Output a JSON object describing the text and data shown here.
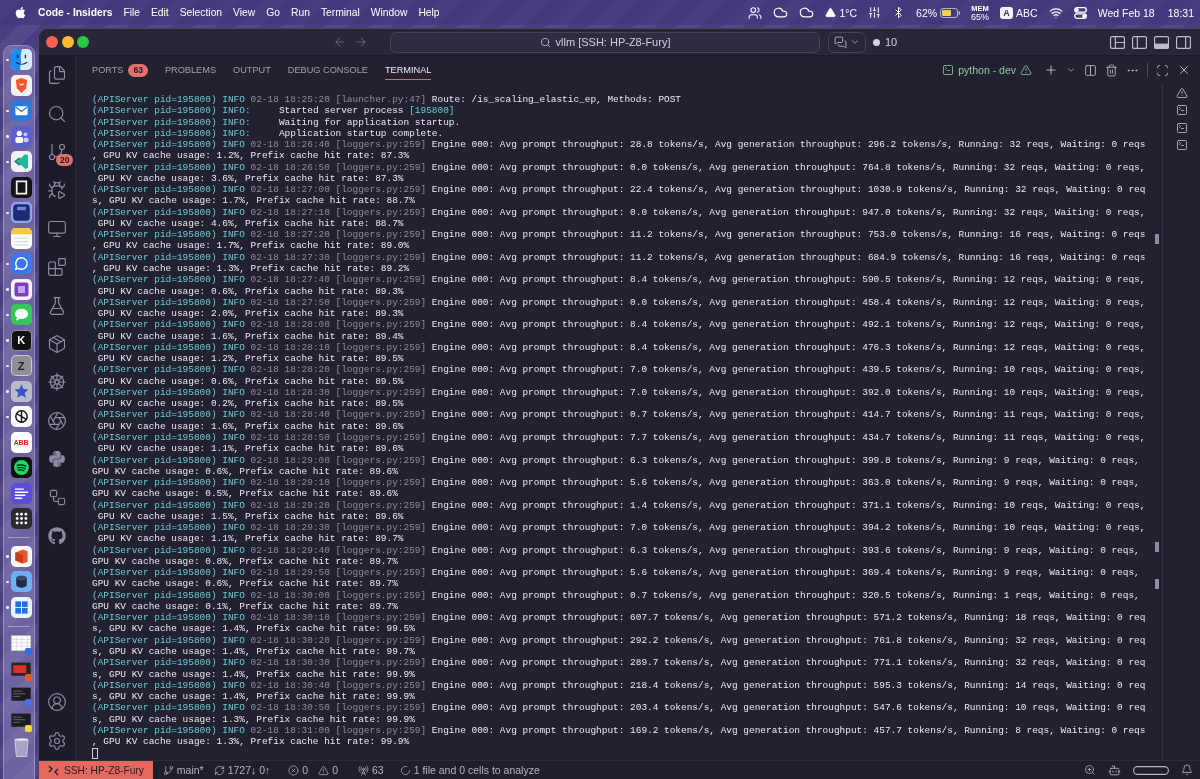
{
  "menu_bar": {
    "app": "Code - Insiders",
    "menus": [
      "File",
      "Edit",
      "Selection",
      "View",
      "Go",
      "Run",
      "Terminal",
      "Window",
      "Help"
    ],
    "weather": "1°C",
    "battery": "62%",
    "memory_label": "MEM",
    "memory": "65%",
    "input_badge": "A",
    "input": "ABC",
    "date": "Wed Feb 18",
    "time": "18:31"
  },
  "dock": {
    "groups": [
      {
        "items": [
          {
            "kind": "finder",
            "running": true
          },
          {
            "kind": "browser",
            "running": false
          },
          {
            "kind": "mail",
            "running": true
          },
          {
            "kind": "team",
            "running": true
          },
          {
            "kind": "editor",
            "running": true
          },
          {
            "kind": "frame",
            "running": false
          },
          {
            "kind": "navy",
            "running": true
          },
          {
            "kind": "notes",
            "running": false
          },
          {
            "kind": "bubble",
            "running": true
          },
          {
            "kind": "notebook",
            "running": true
          },
          {
            "kind": "messages",
            "running": true
          },
          {
            "kind": "darkletter",
            "label": "K",
            "running": true
          },
          {
            "kind": "grayletter",
            "label": "Z",
            "running": true
          },
          {
            "kind": "star",
            "running": true
          },
          {
            "kind": "knot",
            "running": true
          },
          {
            "kind": "lightletter",
            "label": "ABB",
            "running": false
          },
          {
            "kind": "music",
            "running": false
          },
          {
            "kind": "lines",
            "running": false
          },
          {
            "kind": "launcher",
            "running": false
          }
        ]
      },
      {
        "items": [
          {
            "kind": "office",
            "running": true
          },
          {
            "kind": "cylinder",
            "running": true
          },
          {
            "kind": "windows",
            "running": true
          }
        ]
      },
      {
        "items": [
          {
            "kind": "sheet",
            "running": false
          },
          {
            "kind": "redwindow",
            "running": false
          },
          {
            "kind": "darkwindow",
            "running": false
          },
          {
            "kind": "notewindow",
            "running": false
          },
          {
            "kind": "trash",
            "running": false
          }
        ]
      }
    ]
  },
  "window": {
    "title": "vllm [SSH: HP-Z8-Fury]",
    "sessions": "10",
    "layout_toggles": [
      {
        "kind": "sidebar",
        "on": false
      },
      {
        "kind": "panel",
        "on": true
      },
      {
        "kind": "auxiliary",
        "on": false
      }
    ]
  },
  "activity_bar": {
    "items": [
      {
        "kind": "explorer"
      },
      {
        "kind": "search"
      },
      {
        "kind": "scm",
        "badge": "20"
      },
      {
        "kind": "debug"
      },
      {
        "kind": "remote"
      },
      {
        "kind": "extensions"
      },
      {
        "kind": "testing"
      },
      {
        "kind": "containers"
      },
      {
        "kind": "kubernetes"
      },
      {
        "kind": "knot"
      },
      {
        "kind": "python"
      },
      {
        "kind": "diagram"
      },
      {
        "kind": "github"
      }
    ],
    "bottom": [
      {
        "kind": "account"
      },
      {
        "kind": "settings"
      }
    ]
  },
  "panel": {
    "tabs": [
      {
        "label": "PORTS",
        "badge": "63",
        "selected": false
      },
      {
        "label": "PROBLEMS",
        "selected": false
      },
      {
        "label": "OUTPUT",
        "selected": false
      },
      {
        "label": "DEBUG CONSOLE",
        "selected": false
      },
      {
        "label": "TERMINAL",
        "selected": true
      }
    ],
    "terminal_name": "python - dev"
  },
  "terminal": {
    "lines": [
      {
        "kind": "logger",
        "source": "(APIServer pid=195800)",
        "tag": "INFO",
        "stamp": "02-18 18:25:20 [launcher.py:47]",
        "message": "Route: /is_scaling_elastic_ep, Methods: POST"
      },
      {
        "kind": "uvicorn",
        "source": "(APIServer pid=195800)",
        "tag": "INFO:",
        "message": "Started server process",
        "detail": "[195800]"
      },
      {
        "kind": "uvicorn",
        "source": "(APIServer pid=195800)",
        "tag": "INFO:",
        "message": "Waiting for application startup."
      },
      {
        "kind": "uvicorn",
        "source": "(APIServer pid=195800)",
        "tag": "INFO:",
        "message": "Application startup complete."
      },
      {
        "kind": "logger",
        "source": "(APIServer pid=195800)",
        "tag": "INFO",
        "stamp": "02-18 18:26:40 [loggers.py:259]",
        "message": "Engine 000: Avg prompt throughput: 28.8 tokens/s, Avg generation throughput: 296.2 tokens/s, Running: 32 reqs, Waiting: 0 reqs",
        "wrap": ", GPU KV cache usage: 1.2%, Prefix cache hit rate: 87.3%"
      },
      {
        "kind": "logger",
        "source": "(APIServer pid=195800)",
        "tag": "INFO",
        "stamp": "02-18 18:26:50 [loggers.py:259]",
        "message": "Engine 000: Avg prompt throughput: 0.0 tokens/s, Avg generation throughput: 764.8 tokens/s, Running: 32 reqs, Waiting: 0 reqs,",
        "wrap": " GPU KV cache usage: 3.6%, Prefix cache hit rate: 87.3%"
      },
      {
        "kind": "logger",
        "source": "(APIServer pid=195800)",
        "tag": "INFO",
        "stamp": "02-18 18:27:00 [loggers.py:259]",
        "message": "Engine 000: Avg prompt throughput: 22.4 tokens/s, Avg generation throughput: 1030.9 tokens/s, Running: 32 reqs, Waiting: 0 req",
        "wrap": "s, GPU KV cache usage: 1.7%, Prefix cache hit rate: 88.7%"
      },
      {
        "kind": "logger",
        "source": "(APIServer pid=195800)",
        "tag": "INFO",
        "stamp": "02-18 18:27:10 [loggers.py:259]",
        "message": "Engine 000: Avg prompt throughput: 0.0 tokens/s, Avg generation throughput: 947.0 tokens/s, Running: 32 reqs, Waiting: 0 reqs,",
        "wrap": " GPU KV cache usage: 4.6%, Prefix cache hit rate: 88.7%"
      },
      {
        "kind": "logger",
        "source": "(APIServer pid=195800)",
        "tag": "INFO",
        "stamp": "02-18 18:27:20 [loggers.py:259]",
        "message": "Engine 000: Avg prompt throughput: 11.2 tokens/s, Avg generation throughput: 753.0 tokens/s, Running: 16 reqs, Waiting: 0 reqs",
        "wrap": ", GPU KV cache usage: 1.7%, Prefix cache hit rate: 89.0%"
      },
      {
        "kind": "logger",
        "source": "(APIServer pid=195800)",
        "tag": "INFO",
        "stamp": "02-18 18:27:30 [loggers.py:259]",
        "message": "Engine 000: Avg prompt throughput: 11.2 tokens/s, Avg generation throughput: 684.9 tokens/s, Running: 16 reqs, Waiting: 0 reqs",
        "wrap": ", GPU KV cache usage: 1.3%, Prefix cache hit rate: 89.2%"
      },
      {
        "kind": "logger",
        "source": "(APIServer pid=195800)",
        "tag": "INFO",
        "stamp": "02-18 18:27:40 [loggers.py:259]",
        "message": "Engine 000: Avg prompt throughput: 8.4 tokens/s, Avg generation throughput: 590.5 tokens/s, Running: 12 reqs, Waiting: 0 reqs,",
        "wrap": " GPU KV cache usage: 0.6%, Prefix cache hit rate: 89.3%"
      },
      {
        "kind": "logger",
        "source": "(APIServer pid=195800)",
        "tag": "INFO",
        "stamp": "02-18 18:27:50 [loggers.py:259]",
        "message": "Engine 000: Avg prompt throughput: 0.0 tokens/s, Avg generation throughput: 458.4 tokens/s, Running: 12 reqs, Waiting: 0 reqs,",
        "wrap": " GPU KV cache usage: 2.0%, Prefix cache hit rate: 89.3%"
      },
      {
        "kind": "logger",
        "source": "(APIServer pid=195800)",
        "tag": "INFO",
        "stamp": "02-18 18:28:00 [loggers.py:259]",
        "message": "Engine 000: Avg prompt throughput: 8.4 tokens/s, Avg generation throughput: 492.1 tokens/s, Running: 12 reqs, Waiting: 0 reqs,",
        "wrap": " GPU KV cache usage: 1.6%, Prefix cache hit rate: 89.4%"
      },
      {
        "kind": "logger",
        "source": "(APIServer pid=195800)",
        "tag": "INFO",
        "stamp": "02-18 18:28:10 [loggers.py:259]",
        "message": "Engine 000: Avg prompt throughput: 8.4 tokens/s, Avg generation throughput: 476.3 tokens/s, Running: 12 reqs, Waiting: 0 reqs,",
        "wrap": " GPU KV cache usage: 1.2%, Prefix cache hit rate: 89.5%"
      },
      {
        "kind": "logger",
        "source": "(APIServer pid=195800)",
        "tag": "INFO",
        "stamp": "02-18 18:28:20 [loggers.py:259]",
        "message": "Engine 000: Avg prompt throughput: 7.0 tokens/s, Avg generation throughput: 439.5 tokens/s, Running: 10 reqs, Waiting: 0 reqs,",
        "wrap": " GPU KV cache usage: 0.6%, Prefix cache hit rate: 89.5%"
      },
      {
        "kind": "logger",
        "source": "(APIServer pid=195800)",
        "tag": "INFO",
        "stamp": "02-18 18:28:30 [loggers.py:259]",
        "message": "Engine 000: Avg prompt throughput: 7.0 tokens/s, Avg generation throughput: 392.0 tokens/s, Running: 10 reqs, Waiting: 0 reqs,",
        "wrap": " GPU KV cache usage: 0.2%, Prefix cache hit rate: 89.5%"
      },
      {
        "kind": "logger",
        "source": "(APIServer pid=195800)",
        "tag": "INFO",
        "stamp": "02-18 18:28:40 [loggers.py:259]",
        "message": "Engine 000: Avg prompt throughput: 0.7 tokens/s, Avg generation throughput: 414.7 tokens/s, Running: 11 reqs, Waiting: 0 reqs,",
        "wrap": " GPU KV cache usage: 1.6%, Prefix cache hit rate: 89.6%"
      },
      {
        "kind": "logger",
        "source": "(APIServer pid=195800)",
        "tag": "INFO",
        "stamp": "02-18 18:28:50 [loggers.py:259]",
        "message": "Engine 000: Avg prompt throughput: 7.7 tokens/s, Avg generation throughput: 434.7 tokens/s, Running: 11 reqs, Waiting: 0 reqs,",
        "wrap": " GPU KV cache usage: 1.1%, Prefix cache hit rate: 89.6%"
      },
      {
        "kind": "logger",
        "source": "(APIServer pid=195800)",
        "tag": "INFO",
        "stamp": "02-18 18:29:00 [loggers.py:259]",
        "message": "Engine 000: Avg prompt throughput: 6.3 tokens/s, Avg generation throughput: 399.8 tokens/s, Running: 9 reqs, Waiting: 0 reqs,",
        "wrap": "GPU KV cache usage: 0.6%, Prefix cache hit rate: 89.6%"
      },
      {
        "kind": "logger",
        "source": "(APIServer pid=195800)",
        "tag": "INFO",
        "stamp": "02-18 18:29:10 [loggers.py:259]",
        "message": "Engine 000: Avg prompt throughput: 5.6 tokens/s, Avg generation throughput: 363.0 tokens/s, Running: 9 reqs, Waiting: 0 reqs,",
        "wrap": "GPU KV cache usage: 0.5%, Prefix cache hit rate: 89.6%"
      },
      {
        "kind": "logger",
        "source": "(APIServer pid=195800)",
        "tag": "INFO",
        "stamp": "02-18 18:29:20 [loggers.py:259]",
        "message": "Engine 000: Avg prompt throughput: 1.4 tokens/s, Avg generation throughput: 371.1 tokens/s, Running: 10 reqs, Waiting: 0 reqs,",
        "wrap": " GPU KV cache usage: 1.5%, Prefix cache hit rate: 89.6%"
      },
      {
        "kind": "logger",
        "source": "(APIServer pid=195800)",
        "tag": "INFO",
        "stamp": "02-18 18:29:30 [loggers.py:259]",
        "message": "Engine 000: Avg prompt throughput: 7.0 tokens/s, Avg generation throughput: 394.2 tokens/s, Running: 10 reqs, Waiting: 0 reqs,",
        "wrap": " GPU KV cache usage: 1.1%, Prefix cache hit rate: 89.7%"
      },
      {
        "kind": "logger",
        "source": "(APIServer pid=195800)",
        "tag": "INFO",
        "stamp": "02-18 18:29:40 [loggers.py:259]",
        "message": "Engine 000: Avg prompt throughput: 6.3 tokens/s, Avg generation throughput: 393.6 tokens/s, Running: 9 reqs, Waiting: 0 reqs,",
        "wrap": "GPU KV cache usage: 0.8%, Prefix cache hit rate: 89.7%"
      },
      {
        "kind": "logger",
        "source": "(APIServer pid=195800)",
        "tag": "INFO",
        "stamp": "02-18 18:29:50 [loggers.py:259]",
        "message": "Engine 000: Avg prompt throughput: 5.6 tokens/s, Avg generation throughput: 369.4 tokens/s, Running: 9 reqs, Waiting: 0 reqs,",
        "wrap": "GPU KV cache usage: 0.6%, Prefix cache hit rate: 89.7%"
      },
      {
        "kind": "logger",
        "source": "(APIServer pid=195800)",
        "tag": "INFO",
        "stamp": "02-18 18:30:00 [loggers.py:259]",
        "message": "Engine 000: Avg prompt throughput: 0.7 tokens/s, Avg generation throughput: 320.5 tokens/s, Running: 1 reqs, Waiting: 0 reqs,",
        "wrap": "GPU KV cache usage: 0.1%, Prefix cache hit rate: 89.7%"
      },
      {
        "kind": "logger",
        "source": "(APIServer pid=195800)",
        "tag": "INFO",
        "stamp": "02-18 18:30:10 [loggers.py:259]",
        "message": "Engine 000: Avg prompt throughput: 607.7 tokens/s, Avg generation throughput: 571.2 tokens/s, Running: 18 reqs, Waiting: 0 req",
        "wrap": "s, GPU KV cache usage: 1.4%, Prefix cache hit rate: 99.5%"
      },
      {
        "kind": "logger",
        "source": "(APIServer pid=195800)",
        "tag": "INFO",
        "stamp": "02-18 18:30:20 [loggers.py:259]",
        "message": "Engine 000: Avg prompt throughput: 292.2 tokens/s, Avg generation throughput: 761.8 tokens/s, Running: 32 reqs, Waiting: 0 req",
        "wrap": "s, GPU KV cache usage: 1.4%, Prefix cache hit rate: 99.7%"
      },
      {
        "kind": "logger",
        "source": "(APIServer pid=195800)",
        "tag": "INFO",
        "stamp": "02-18 18:30:30 [loggers.py:259]",
        "message": "Engine 000: Avg prompt throughput: 289.7 tokens/s, Avg generation throughput: 771.1 tokens/s, Running: 32 reqs, Waiting: 0 req",
        "wrap": "s, GPU KV cache usage: 1.4%, Prefix cache hit rate: 99.9%"
      },
      {
        "kind": "logger",
        "source": "(APIServer pid=195800)",
        "tag": "INFO",
        "stamp": "02-18 18:30:40 [loggers.py:259]",
        "message": "Engine 000: Avg prompt throughput: 218.4 tokens/s, Avg generation throughput: 595.3 tokens/s, Running: 14 reqs, Waiting: 0 req",
        "wrap": "s, GPU KV cache usage: 1.4%, Prefix cache hit rate: 99.9%"
      },
      {
        "kind": "logger",
        "source": "(APIServer pid=195800)",
        "tag": "INFO",
        "stamp": "02-18 18:30:50 [loggers.py:259]",
        "message": "Engine 000: Avg prompt throughput: 203.4 tokens/s, Avg generation throughput: 547.6 tokens/s, Running: 10 reqs, Waiting: 0 req",
        "wrap": "s, GPU KV cache usage: 1.3%, Prefix cache hit rate: 99.9%"
      },
      {
        "kind": "logger",
        "source": "(APIServer pid=195800)",
        "tag": "INFO",
        "stamp": "02-18 18:31:00 [loggers.py:259]",
        "message": "Engine 000: Avg prompt throughput: 169.2 tokens/s, Avg generation throughput: 457.7 tokens/s, Running: 8 reqs, Waiting: 0 reqs",
        "wrap": ", GPU KV cache usage: 1.3%, Prefix cache hit rate: 99.9%"
      }
    ],
    "tabs": [
      {
        "kind": "warning"
      },
      {
        "kind": "shell"
      },
      {
        "kind": "shell"
      },
      {
        "kind": "shell"
      }
    ]
  },
  "status_bar": {
    "remote": "SSH: HP-Z8-Fury",
    "branch": "main*",
    "sync": "1727↓ 0↑",
    "errors": "0",
    "warnings": "0",
    "ports": "63",
    "analysis": "1 file and 0 cells to analyze"
  }
}
